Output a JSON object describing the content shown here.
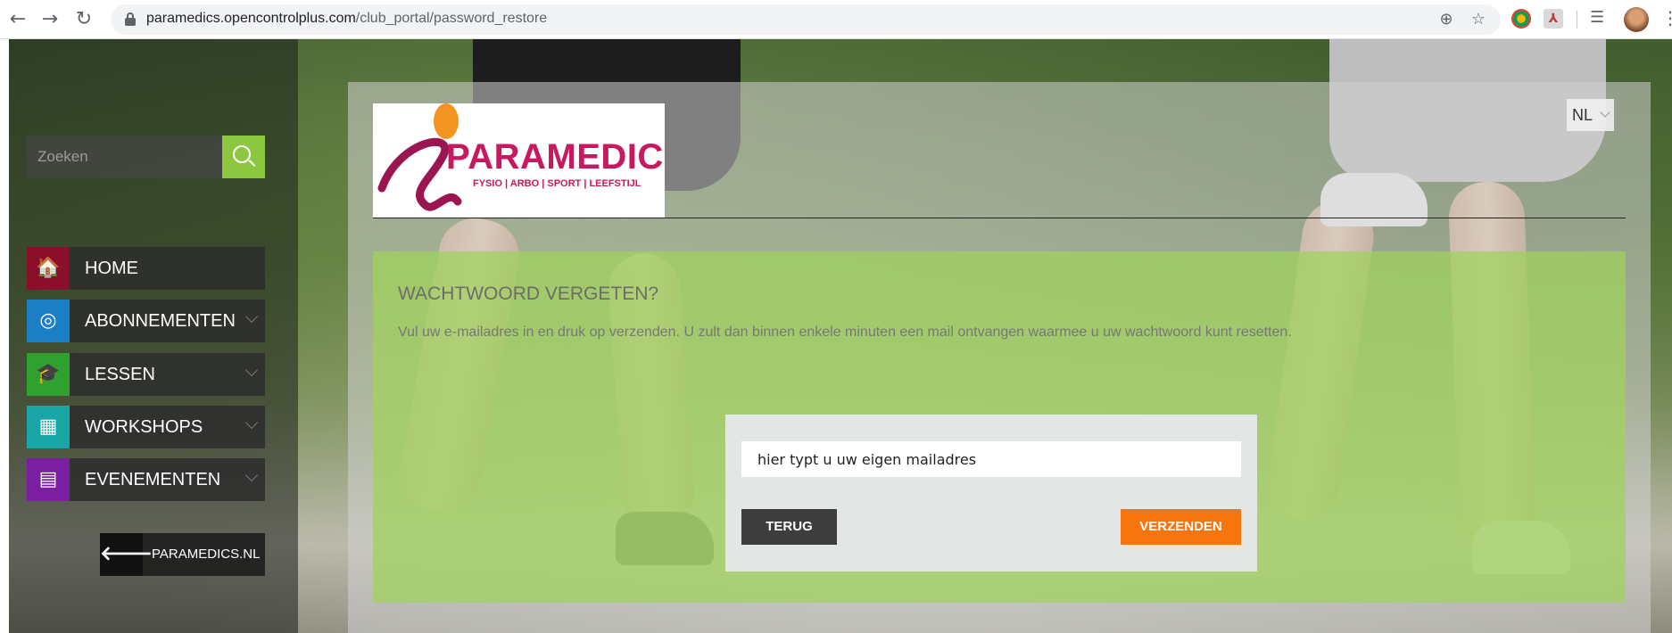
{
  "browser": {
    "url_domain": "paramedics.opencontrolplus.com",
    "url_path": "/club_portal/password_restore",
    "icons": [
      "back-arrow-icon",
      "forward-arrow-icon",
      "reload-icon",
      "lock-icon",
      "add-icon",
      "star-icon",
      "extension-icon",
      "pdf-icon",
      "reading-list-icon",
      "profile-avatar",
      "menu-kebab-icon"
    ]
  },
  "sidebar": {
    "search_placeholder": "Zoeken",
    "items": [
      {
        "label": "HOME",
        "icon": "home-icon",
        "color": "#8a0f2a",
        "glyph": "🏠"
      },
      {
        "label": "ABONNEMENTEN",
        "icon": "subscriptions-icon",
        "color": "#1b7fc6",
        "glyph": "◎"
      },
      {
        "label": "LESSEN",
        "icon": "graduation-cap-icon",
        "color": "#2ea12e",
        "glyph": "🎓"
      },
      {
        "label": "WORKSHOPS",
        "icon": "workshop-icon",
        "color": "#1aa6a6",
        "glyph": "▦"
      },
      {
        "label": "EVENEMENTEN",
        "icon": "calendar-icon",
        "color": "#7b1fa2",
        "glyph": "▤"
      }
    ],
    "back_link": {
      "label": "PARAMEDICS.NL",
      "glyph": "🡐"
    }
  },
  "header": {
    "logo": {
      "name": "PARAMEDICS",
      "tagline": "FYSIO | ARBO | SPORT | LEEFSTIJL"
    },
    "language": "NL"
  },
  "content": {
    "title": "WACHTWOORD VERGETEN?",
    "description": "Vul uw e-mailadres in en druk op verzenden. U zult dan binnen enkele minuten een mail ontvangen waarmee u uw wachtwoord kunt resetten.",
    "email_value": "hier typt u uw eigen mailadres",
    "back_button": "TERUG",
    "send_button": "VERZENDEN"
  },
  "colors": {
    "accent_green": "#8dc63f",
    "send_orange": "#f7750e",
    "brand_magenta": "#c8185f"
  }
}
